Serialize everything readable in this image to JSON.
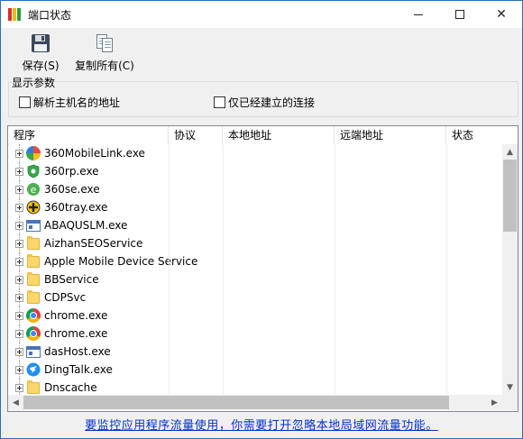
{
  "window": {
    "title": "端口状态",
    "controls": {
      "minimize_icon": "minimize-icon",
      "maximize_icon": "maximize-icon",
      "close_symbol": "✕"
    }
  },
  "toolbar": {
    "save_label": "保存(S)",
    "save_icon": "floppy-disk-icon",
    "copy_all_label": "复制所有(C)",
    "copy_all_icon": "copy-documents-icon"
  },
  "display_params": {
    "title": "显示参数",
    "resolve_hostname_label": "解析主机名的地址",
    "resolve_hostname_checked": false,
    "established_only_label": "仅已经建立的连接",
    "established_only_checked": false
  },
  "table": {
    "columns": [
      "程序",
      "协议",
      "本地地址",
      "远端地址",
      "状态"
    ],
    "rows": [
      {
        "name": "360MobileLink.exe",
        "icon": "360-mobile-icon"
      },
      {
        "name": "360rp.exe",
        "icon": "360-shield-icon"
      },
      {
        "name": "360se.exe",
        "icon": "360-browser-icon"
      },
      {
        "name": "360tray.exe",
        "icon": "360-tray-icon"
      },
      {
        "name": "ABAQUSLM.exe",
        "icon": "window-icon"
      },
      {
        "name": "AizhanSEOService",
        "icon": "folder-icon"
      },
      {
        "name": "Apple Mobile Device Service",
        "icon": "folder-icon"
      },
      {
        "name": "BBService",
        "icon": "folder-icon"
      },
      {
        "name": "CDPSvc",
        "icon": "folder-icon"
      },
      {
        "name": "chrome.exe",
        "icon": "chrome-icon"
      },
      {
        "name": "chrome.exe",
        "icon": "chrome-icon"
      },
      {
        "name": "dasHost.exe",
        "icon": "window-icon"
      },
      {
        "name": "DingTalk.exe",
        "icon": "dingtalk-icon"
      },
      {
        "name": "Dnscache",
        "icon": "folder-icon"
      }
    ],
    "scroll_up": "▲",
    "scroll_down": "▼",
    "scroll_left": "◀",
    "scroll_right": "▶"
  },
  "footer": {
    "link_text": "要监控应用程序流量使用，你需要打开忽略本地局域网流量功能。"
  },
  "colors": {
    "link": "#0033cc",
    "window_border": "#2b6fb3",
    "folder": "#fbd66a"
  }
}
